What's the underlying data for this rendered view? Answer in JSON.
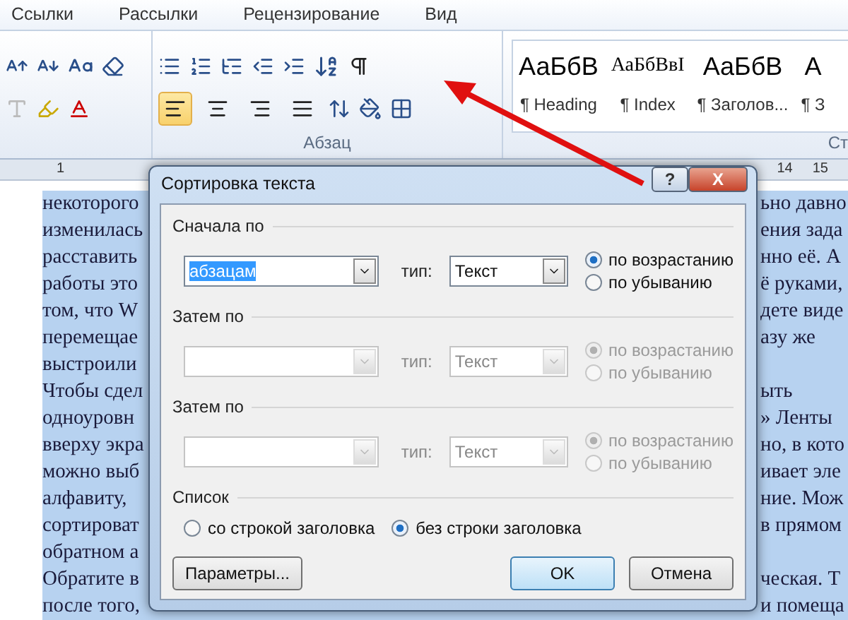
{
  "ribbon_tabs": [
    "Ссылки",
    "Рассылки",
    "Рецензирование",
    "Вид"
  ],
  "paragraph_group": {
    "label": "Абзац",
    "align_buttons": [
      {
        "kind": "left",
        "selected": true
      },
      {
        "kind": "center",
        "selected": false
      },
      {
        "kind": "right",
        "selected": false
      },
      {
        "kind": "justify",
        "selected": false
      }
    ]
  },
  "styles": [
    {
      "sample": "АаБбВ",
      "name": "¶ Heading",
      "kind": "sans"
    },
    {
      "sample": "АаБбВвІ",
      "name": "¶ Index",
      "kind": "serif"
    },
    {
      "sample": "АаБбВ",
      "name": "¶ Заголов...",
      "kind": "sans"
    },
    {
      "sample": "А",
      "name": "¶ З",
      "kind": "sans"
    }
  ],
  "styles_group_label": "Ст",
  "ruler": {
    "left_mark": "1",
    "right_marks": [
      "14",
      "15"
    ]
  },
  "document": {
    "lines": [
      {
        "left": "некоторого",
        "right": "ьно давно"
      },
      {
        "left": "изменилась",
        "right": "ения зада"
      },
      {
        "left": "расставить",
        "right": "нно её. А"
      },
      {
        "left": "работы это",
        "right": "ё руками,"
      },
      {
        "left": "том, что W",
        "right": "дете виде"
      },
      {
        "left": "перемещае",
        "right": "азу же"
      },
      {
        "left": "выстроили"
      },
      {
        "left": "Чтобы сдел",
        "right": "ыть"
      },
      {
        "left": "одноуровн",
        "right": "» Ленты"
      },
      {
        "left": "вверху экра",
        "right": "но, в кото"
      },
      {
        "left": "можно выб",
        "right": "ивает эле"
      },
      {
        "left": "алфавиту,",
        "right": "ние. Мож"
      },
      {
        "left": "сортироват",
        "right": "в прямом"
      },
      {
        "left": "обратном а"
      },
      {
        "left": "Обратите в",
        "right": "ческая. Т"
      },
      {
        "left": "после того,",
        "right": "и помеща"
      }
    ]
  },
  "dialog": {
    "title": "Сортировка текста",
    "help": "?",
    "close": "X",
    "sections": [
      {
        "label": "Сначала по",
        "disabled": false,
        "value": "абзацам",
        "type_label": "тип:",
        "type_value": "Текст",
        "options": [
          {
            "label": "по возрастанию",
            "selected": true
          },
          {
            "label": "по убыванию",
            "selected": false
          }
        ]
      },
      {
        "label": "Затем по",
        "disabled": true,
        "type_label": "тип:",
        "type_value": "Текст",
        "options": [
          {
            "label": "по возрастанию",
            "selected": true
          },
          {
            "label": "по убыванию",
            "selected": false
          }
        ]
      },
      {
        "label": "Затем по",
        "disabled": true,
        "type_label": "тип:",
        "type_value": "Текст",
        "options": [
          {
            "label": "по возрастанию",
            "selected": true
          },
          {
            "label": "по убыванию",
            "selected": false
          }
        ]
      }
    ],
    "list_section": {
      "label": "Список",
      "options": [
        {
          "label": "со строкой заголовка",
          "selected": false
        },
        {
          "label": "без строки заголовка",
          "selected": true
        }
      ]
    },
    "buttons": [
      {
        "label": "Параметры...",
        "kind": "options"
      },
      {
        "label": "OK",
        "kind": "default"
      },
      {
        "label": "Отмена",
        "kind": "cancel"
      }
    ]
  }
}
